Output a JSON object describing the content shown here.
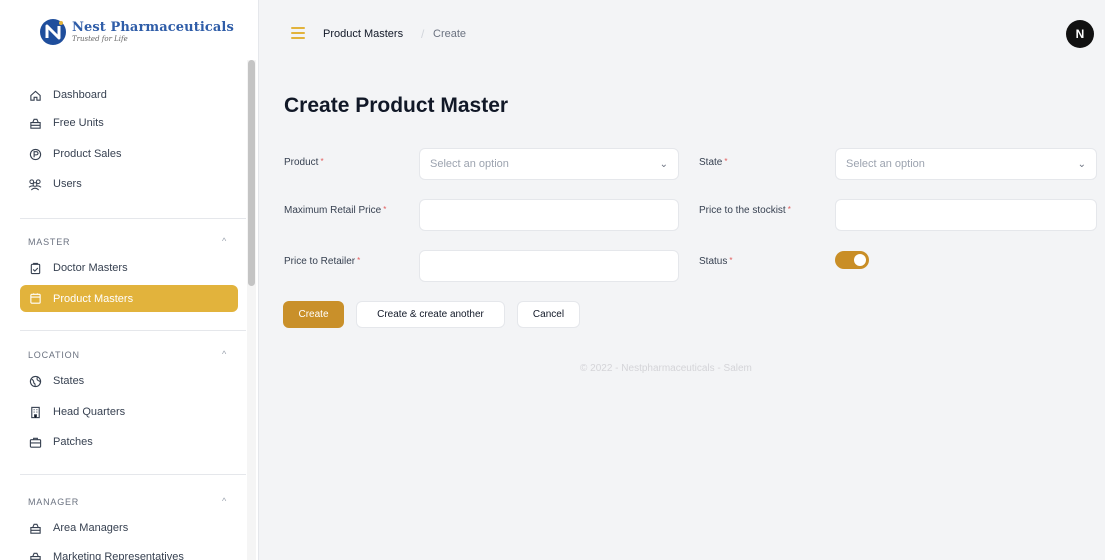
{
  "brand": {
    "name": "Nest Pharmaceuticals",
    "tagline": "Trusted for Life",
    "logo_letter": "N"
  },
  "sidebar": {
    "main_items": [
      {
        "label": "Dashboard",
        "icon": "home-icon"
      },
      {
        "label": "Free Units",
        "icon": "bag-icon"
      },
      {
        "label": "Product Sales",
        "icon": "product-sales-icon"
      },
      {
        "label": "Users",
        "icon": "users-icon"
      }
    ],
    "sections": [
      {
        "label": "MASTER",
        "items": [
          {
            "label": "Doctor Masters",
            "icon": "clipboard-icon"
          },
          {
            "label": "Product Masters",
            "icon": "calendar-icon",
            "active": true
          }
        ]
      },
      {
        "label": "LOCATION",
        "items": [
          {
            "label": "States",
            "icon": "globe-icon"
          },
          {
            "label": "Head Quarters",
            "icon": "building-icon"
          },
          {
            "label": "Patches",
            "icon": "briefcase-icon"
          }
        ]
      },
      {
        "label": "MANAGER",
        "items": [
          {
            "label": "Area Managers",
            "icon": "bag-icon"
          },
          {
            "label": "Marketing Representatives",
            "icon": "bag-icon"
          }
        ]
      }
    ]
  },
  "breadcrumb": {
    "items": [
      "Product Masters",
      "Create"
    ],
    "separator": "/"
  },
  "user": {
    "avatar_initial": "N"
  },
  "page": {
    "title": "Create Product Master"
  },
  "form": {
    "product": {
      "label": "Product",
      "placeholder": "Select an option"
    },
    "state": {
      "label": "State",
      "placeholder": "Select an option"
    },
    "mrp": {
      "label": "Maximum Retail Price",
      "value": ""
    },
    "price_stockist": {
      "label": "Price to the stockist",
      "value": ""
    },
    "price_retailer": {
      "label": "Price to Retailer",
      "value": ""
    },
    "status": {
      "label": "Status",
      "enabled": true
    },
    "required_mark": "*"
  },
  "actions": {
    "create": "Create",
    "create_another": "Create & create another",
    "cancel": "Cancel"
  },
  "footer": {
    "text": "© 2022 - Nestpharmaceuticals - Salem"
  },
  "colors": {
    "accent": "#e2b33c",
    "primary_button": "#c9902a",
    "toggle_on": "#c98e26",
    "brand_blue": "#2f5da8"
  }
}
